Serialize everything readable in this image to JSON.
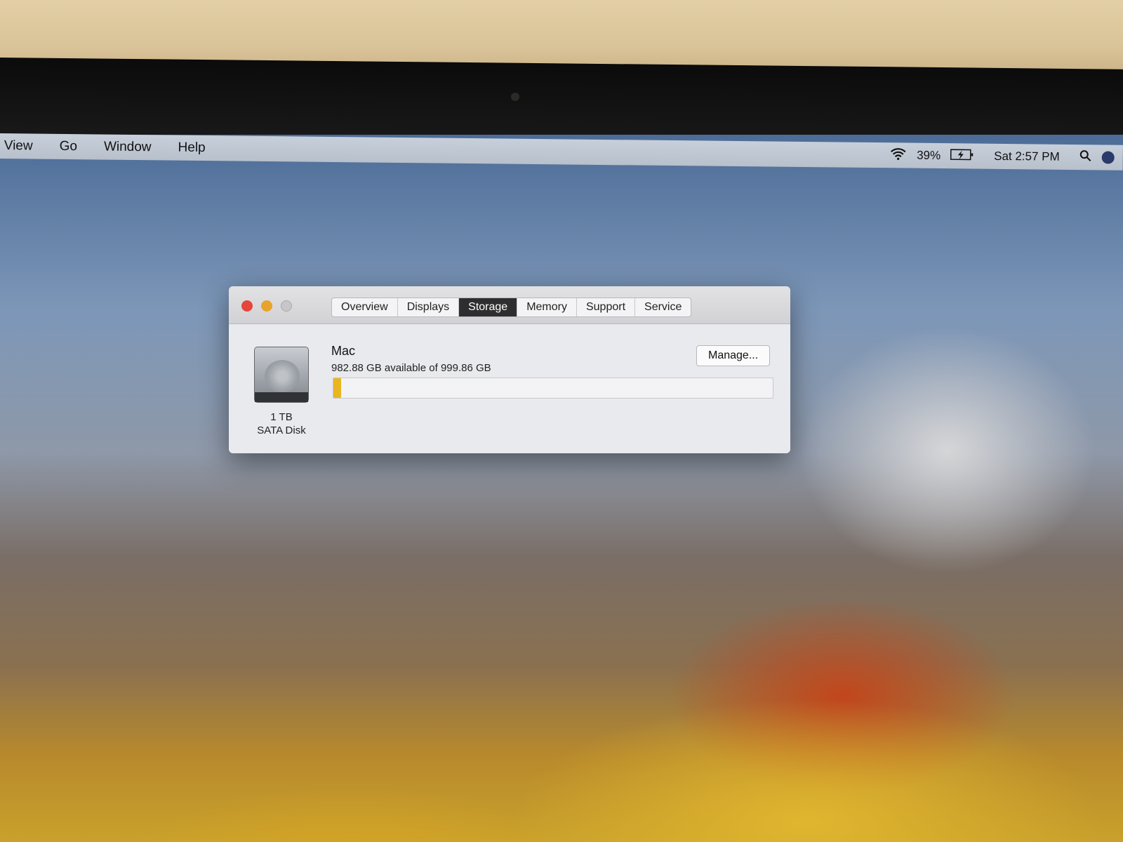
{
  "menubar": {
    "items": [
      "View",
      "Go",
      "Window",
      "Help"
    ],
    "battery": "39%",
    "clock": "Sat 2:57 PM"
  },
  "window": {
    "tabs": [
      "Overview",
      "Displays",
      "Storage",
      "Memory",
      "Support",
      "Service"
    ],
    "active_tab": "Storage",
    "disk": {
      "size": "1 TB",
      "type": "SATA Disk",
      "volume": "Mac",
      "available": "982.88 GB available of 999.86 GB",
      "used_fraction": 0.017,
      "used_color": "#e8b623"
    },
    "manage_label": "Manage..."
  }
}
